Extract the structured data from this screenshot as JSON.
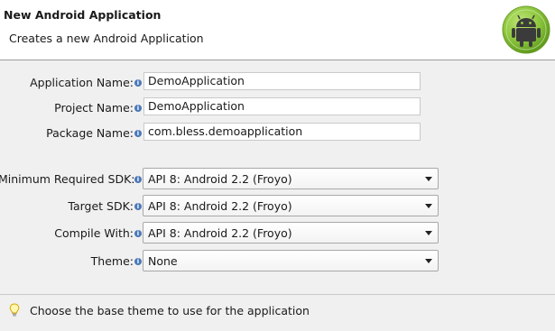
{
  "header": {
    "title": "New Android Application",
    "subtitle": "Creates a new Android Application",
    "logo_icon": "android-logo-icon"
  },
  "form": {
    "application_name": {
      "label": "Application Name:",
      "value": "DemoApplication"
    },
    "project_name": {
      "label": "Project Name:",
      "value": "DemoApplication"
    },
    "package_name": {
      "label": "Package Name:",
      "value": "com.bless.demoapplication"
    },
    "min_sdk": {
      "label": "Minimum Required SDK:",
      "value": "API 8: Android 2.2 (Froyo)"
    },
    "target_sdk": {
      "label": "Target SDK:",
      "value": "API 8: Android 2.2 (Froyo)"
    },
    "compile_with": {
      "label": "Compile With:",
      "value": "API 8: Android 2.2 (Froyo)"
    },
    "theme": {
      "label": "Theme:",
      "value": "None"
    },
    "info_icon": "info-icon"
  },
  "hint": {
    "icon": "lightbulb-icon",
    "text": "Choose the base theme to use for the application"
  },
  "colors": {
    "header_bg": "#ffffff",
    "page_bg": "#f0f0f0",
    "info_blue": "#4a78b8",
    "android_green": "#8cc63e"
  }
}
